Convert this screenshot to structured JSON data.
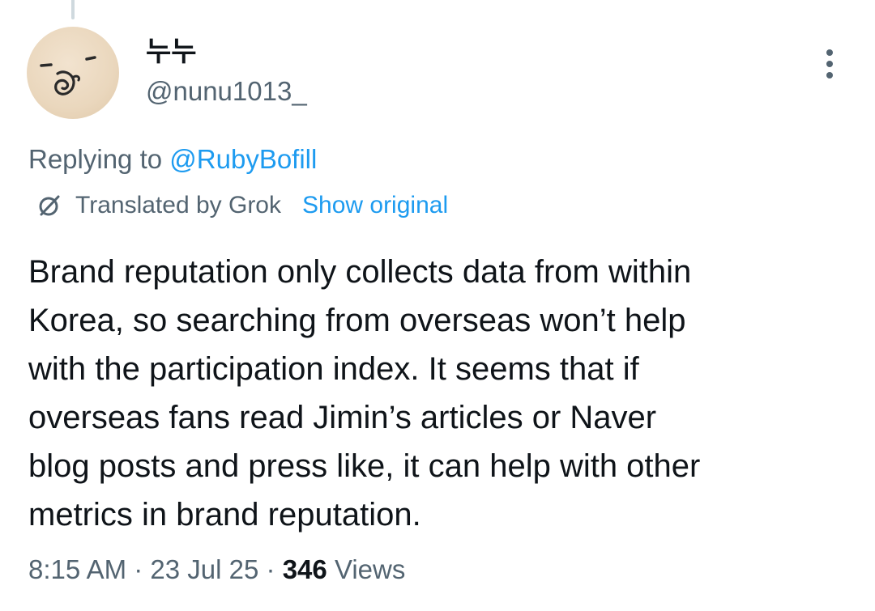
{
  "author": {
    "display_name": "누누",
    "handle": "@nunu1013_"
  },
  "reply": {
    "prefix": "Replying to",
    "mention": "@RubyBofill"
  },
  "translation": {
    "label": "Translated by Grok",
    "show_original": "Show original"
  },
  "tweet": {
    "lines": [
      "Brand reputation only collects data from within",
      "Korea, so searching from overseas won’t help",
      "with the participation index. It seems that if",
      "overseas fans read Jimin’s articles or Naver",
      "blog posts and press like, it can help with other",
      "metrics in brand reputation."
    ]
  },
  "meta": {
    "time": "8:15 AM",
    "separator": "·",
    "date": "23 Jul 25",
    "views_count": "346",
    "views_label": "Views"
  },
  "icons": {
    "more": "more-options-icon",
    "translate": "grok-icon"
  },
  "colors": {
    "accent": "#1d9bf0",
    "secondary_text": "#536471",
    "primary_text": "#0f1419"
  }
}
